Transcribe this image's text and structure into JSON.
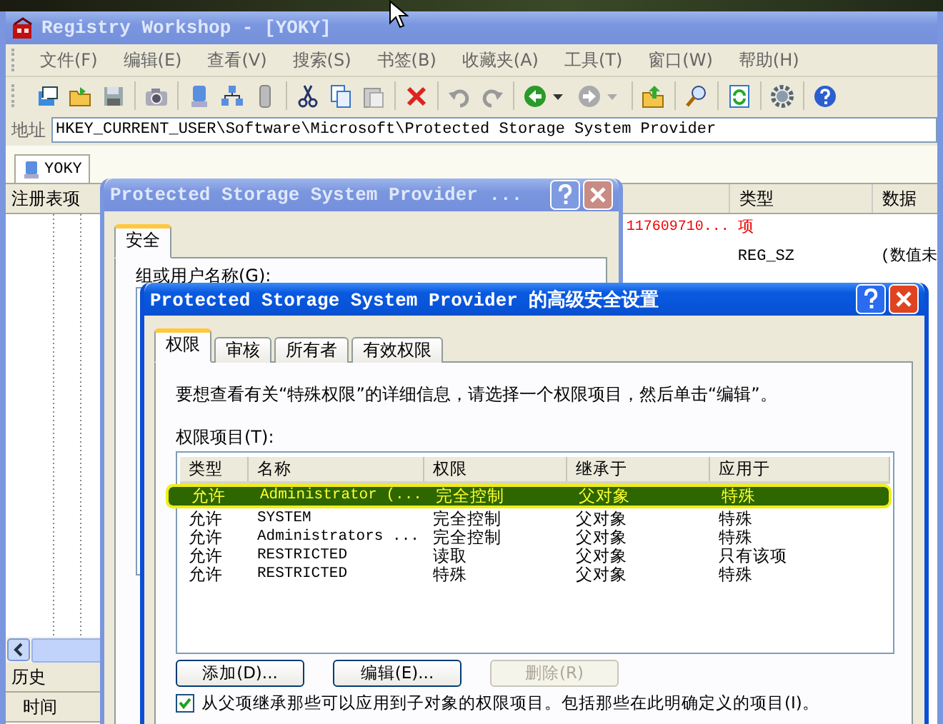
{
  "main_window": {
    "title": "Registry Workshop - [YOKY]",
    "menu": [
      "文件(F)",
      "编辑(E)",
      "查看(V)",
      "搜索(S)",
      "书签(B)",
      "收藏夹(A)",
      "工具(T)",
      "窗口(W)",
      "帮助(H)"
    ],
    "address": {
      "label": "地址",
      "value": "HKEY_CURRENT_USER\\Software\\Microsoft\\Protected Storage System Provider"
    },
    "tabs": [
      {
        "label": "YOKY",
        "selected": true
      }
    ],
    "tree_panel": {
      "header": "注册表项"
    },
    "list": {
      "columns": [
        "类型",
        "数据"
      ],
      "rows": [
        {
          "kind": "key",
          "column_1": "117609710...",
          "type": "项"
        },
        {
          "kind": "value",
          "type": "REG_SZ",
          "data": "(数值未"
        }
      ]
    },
    "history": {
      "header": "历史",
      "columns": [
        "时间"
      ]
    }
  },
  "properties_dialog": {
    "title": "Protected Storage System Provider ...",
    "tabs": [
      {
        "label": "安全",
        "selected": true
      }
    ],
    "group_label": "组或用户名称(G):"
  },
  "advanced_dialog": {
    "title": "Protected Storage System Provider 的高级安全设置",
    "tabs": [
      {
        "label": "权限",
        "selected": true
      },
      {
        "label": "审核",
        "selected": false
      },
      {
        "label": "所有者",
        "selected": false
      },
      {
        "label": "有效权限",
        "selected": false
      }
    ],
    "info": "要想查看有关“特殊权限”的详细信息，请选择一个权限项目，然后单击“编辑”。",
    "list_label": "权限项目(T):",
    "columns": [
      "类型",
      "名称",
      "权限",
      "继承于",
      "应用于"
    ],
    "rows": [
      {
        "type": "允许",
        "name": "Administrator (...",
        "permission": "完全控制",
        "inherited_from": "父对象",
        "applies_to": "特殊",
        "selected": true
      },
      {
        "type": "允许",
        "name": "SYSTEM",
        "permission": "完全控制",
        "inherited_from": "父对象",
        "applies_to": "特殊",
        "selected": false
      },
      {
        "type": "允许",
        "name": "Administrators ...",
        "permission": "完全控制",
        "inherited_from": "父对象",
        "applies_to": "特殊",
        "selected": false
      },
      {
        "type": "允许",
        "name": "RESTRICTED",
        "permission": "读取",
        "inherited_from": "父对象",
        "applies_to": "只有该项",
        "selected": false
      },
      {
        "type": "允许",
        "name": "RESTRICTED",
        "permission": "特殊",
        "inherited_from": "父对象",
        "applies_to": "特殊",
        "selected": false
      }
    ],
    "buttons": [
      {
        "label": "添加(D)...",
        "disabled": false
      },
      {
        "label": "编辑(E)...",
        "disabled": false
      },
      {
        "label": "删除(R)",
        "disabled": true
      }
    ],
    "inherit_checkbox": {
      "label": "从父项继承那些可以应用到子对象的权限项目。包括那些在此明确定义的项目(I)。",
      "checked": true
    }
  }
}
